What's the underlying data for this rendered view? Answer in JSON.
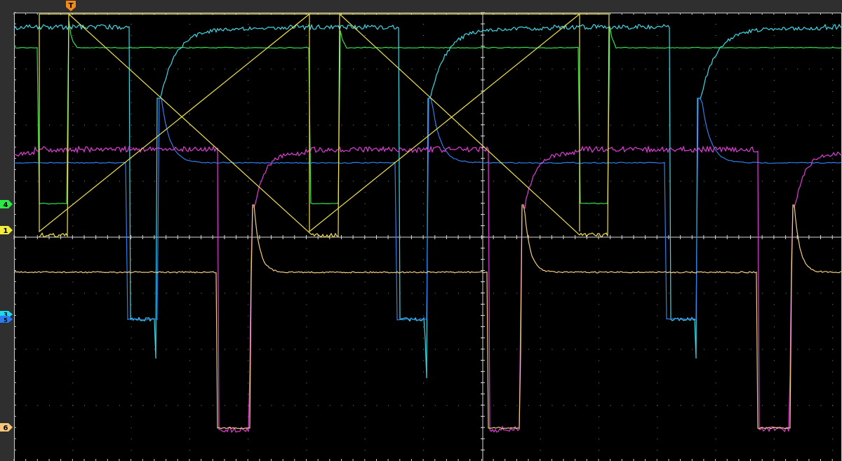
{
  "trigger": {
    "label": "T",
    "color": "#f08a1c"
  },
  "channels": [
    {
      "id": "4",
      "label": "4",
      "color": "#2ee84a"
    },
    {
      "id": "1",
      "label": "1",
      "color": "#f4ec3a"
    },
    {
      "id": "3",
      "label": "3",
      "color": "#24d8ec"
    },
    {
      "id": "5",
      "label": "5",
      "color": "#2b7cf0"
    },
    {
      "id": "6",
      "label": "6",
      "color": "#f5c77a"
    }
  ],
  "traces": [
    {
      "name": "cyan-trace",
      "color": "#3ad9e6"
    },
    {
      "name": "green-trace",
      "color": "#2fe04a"
    },
    {
      "name": "magenta-trace",
      "color": "#e03cd8"
    },
    {
      "name": "blue-trace",
      "color": "#2f7ff0"
    },
    {
      "name": "yellow-trace",
      "color": "#f0e24a"
    },
    {
      "name": "orange-trace",
      "color": "#f2cd7e"
    }
  ],
  "colors": {
    "background": "#000000",
    "frame": "#2f2f2f",
    "grid": "#9a9a9a",
    "axis": "#d8d8d8"
  }
}
